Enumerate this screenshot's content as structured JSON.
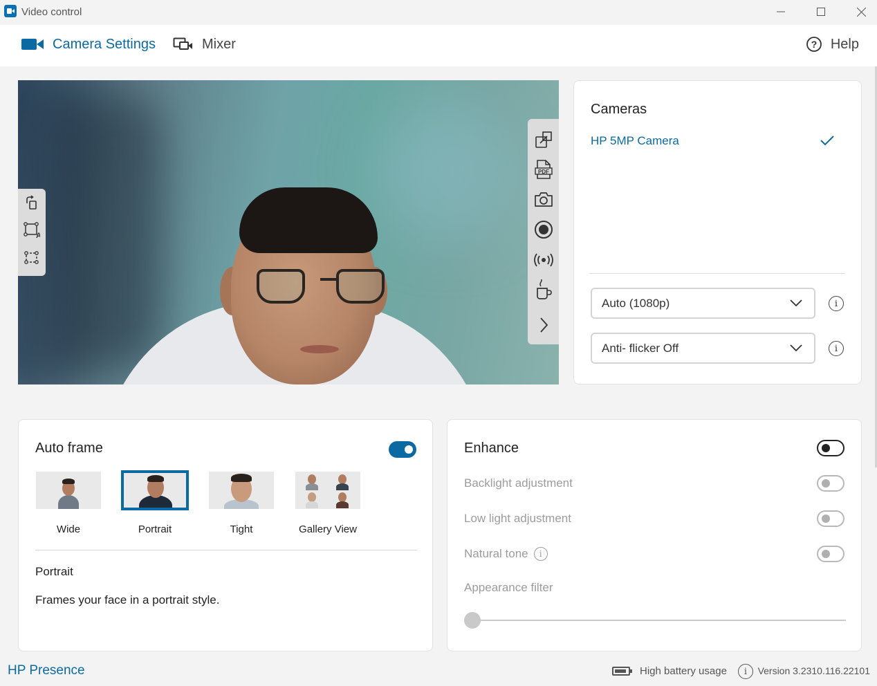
{
  "window": {
    "title": "Video control",
    "controls": [
      "minimize",
      "maximize",
      "close"
    ]
  },
  "nav": {
    "camera_settings": "Camera Settings",
    "mixer": "Mixer",
    "help": "Help"
  },
  "video": {
    "left_tools": [
      "rotate-icon",
      "frame-text-icon",
      "frame-points-icon"
    ],
    "right_tools": [
      "popout-icon",
      "pdf-icon",
      "camera-snapshot-icon",
      "record-icon",
      "broadcast-icon",
      "coffee-break-icon",
      "chevron-right-icon"
    ]
  },
  "cameras": {
    "title": "Cameras",
    "items": [
      {
        "name": "HP 5MP Camera",
        "selected": true
      }
    ],
    "resolution": {
      "value": "Auto (1080p)"
    },
    "antiflicker": {
      "value": "Anti- flicker Off"
    }
  },
  "autoframe": {
    "title": "Auto frame",
    "enabled": true,
    "options": [
      {
        "label": "Wide",
        "selected": false
      },
      {
        "label": "Portrait",
        "selected": true
      },
      {
        "label": "Tight",
        "selected": false
      },
      {
        "label": "Gallery View",
        "selected": false
      }
    ],
    "mode_title": "Portrait",
    "description": "Frames your face in a portrait style."
  },
  "enhance": {
    "title": "Enhance",
    "enabled": false,
    "options": [
      {
        "label": "Backlight adjustment",
        "enabled": false
      },
      {
        "label": "Low light adjustment",
        "enabled": false
      },
      {
        "label": "Natural tone",
        "enabled": false
      }
    ],
    "appearance_filter": {
      "label": "Appearance filter",
      "value": 0
    }
  },
  "footer": {
    "brand": "HP Presence",
    "battery_text": "High battery usage",
    "version": "Version 3.2310.116.22101"
  },
  "colors": {
    "accent": "#0b6aa2",
    "disabled_text": "#9c9c9c",
    "background": "#f3f3f3"
  }
}
